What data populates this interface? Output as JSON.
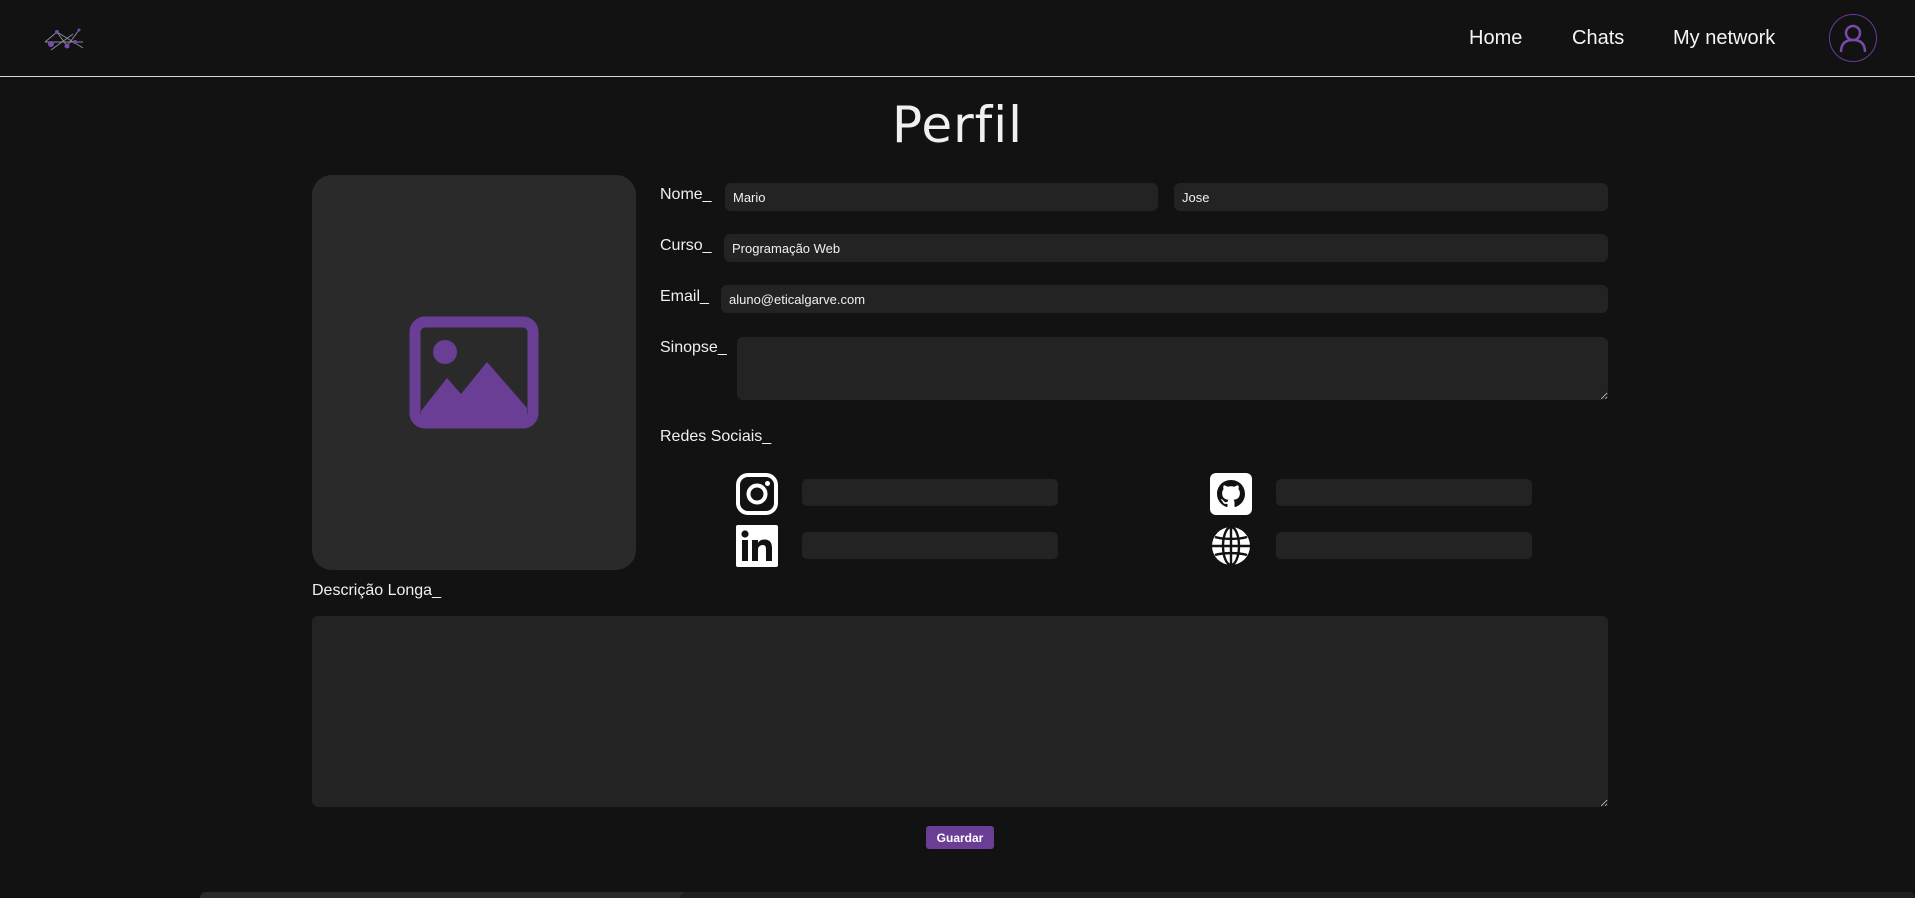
{
  "nav": {
    "links": [
      "Home",
      "Chats",
      "My network"
    ]
  },
  "page": {
    "title": "Perfil"
  },
  "form": {
    "nome_label": "Nome_",
    "first_name": "Mario",
    "last_name": "Jose",
    "curso_label": "Curso_",
    "curso": "Programação Web",
    "email_label": "Email_",
    "email": "aluno@eticalgarve.com",
    "sinopse_label": "Sinopse_",
    "sinopse": "",
    "redes_label": "Redes Sociais_",
    "descricao_label": "Descrição Longa_",
    "descricao": "",
    "save_label": "Guardar"
  },
  "social": [
    {
      "icon": "instagram-icon",
      "value": ""
    },
    {
      "icon": "github-icon",
      "value": ""
    },
    {
      "icon": "linkedin-icon",
      "value": ""
    },
    {
      "icon": "globe-icon",
      "value": ""
    }
  ],
  "colors": {
    "background": "#121212",
    "accent": "#6b3e96",
    "field": "#232323",
    "photo_box": "#2a2a2a"
  }
}
